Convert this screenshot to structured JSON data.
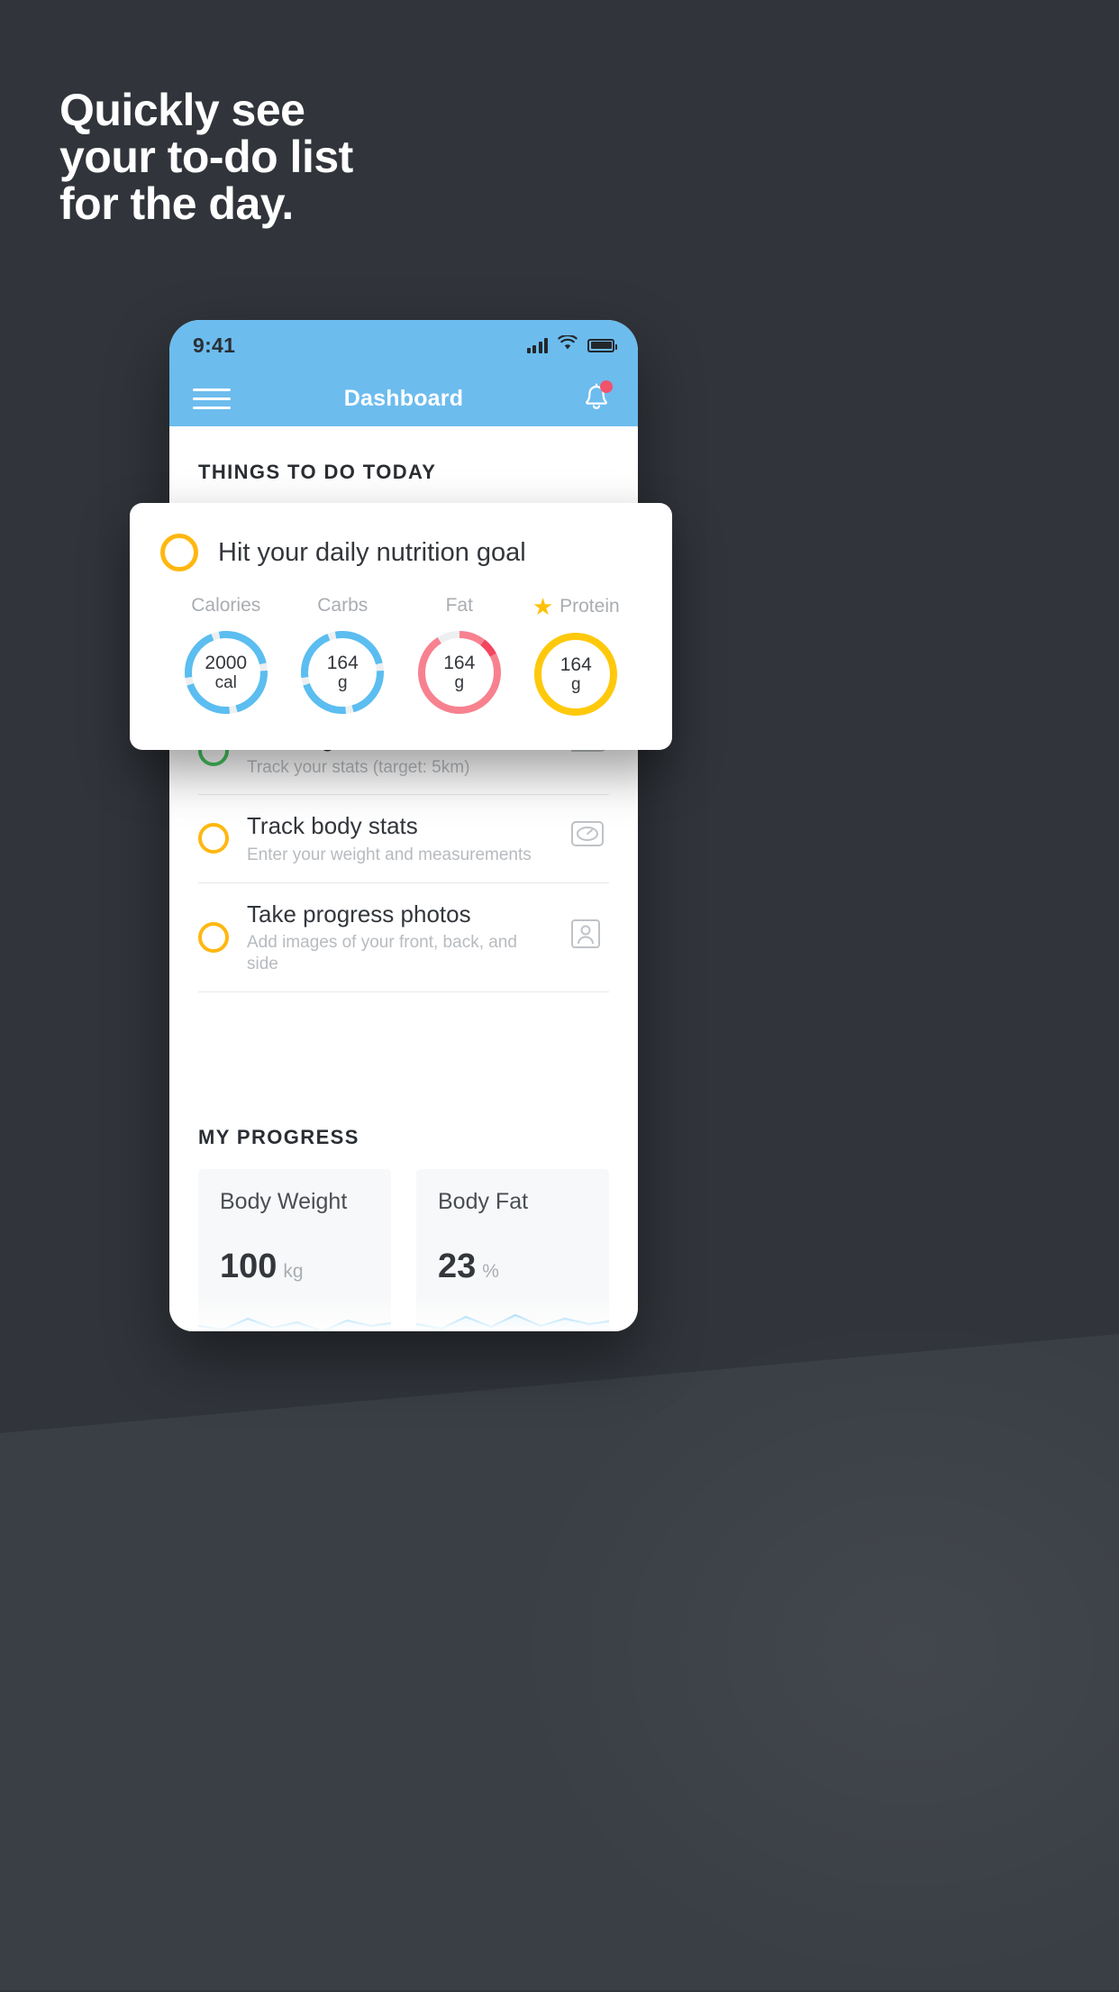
{
  "headline": {
    "line1": "Quickly see",
    "line2": "your to-do list",
    "line3": "for the day."
  },
  "colors": {
    "background": "#31353B",
    "accent_blue": "#6CBCEE",
    "accent_yellow": "#FFB710",
    "accent_green": "#46C45E",
    "accent_red": "#F8818F",
    "notification_dot": "#F0536B"
  },
  "phone": {
    "status_bar": {
      "time": "9:41",
      "signal_icon": "signal-bars-icon",
      "wifi_icon": "wifi-icon",
      "battery_icon": "battery-icon"
    },
    "app_bar": {
      "menu_icon": "hamburger-menu-icon",
      "title": "Dashboard",
      "notification_icon": "bell-icon"
    },
    "todo_section": {
      "title": "THINGS TO DO TODAY",
      "items": [
        {
          "title": "Running",
          "subtitle": "Track your stats (target: 5km)",
          "ring_color": "green",
          "icon": "running-shoe-icon"
        },
        {
          "title": "Track body stats",
          "subtitle": "Enter your weight and measurements",
          "ring_color": "yellow",
          "icon": "scale-icon"
        },
        {
          "title": "Take progress photos",
          "subtitle": "Add images of your front, back, and side",
          "ring_color": "yellow",
          "icon": "photo-person-icon"
        }
      ]
    },
    "progress_section": {
      "title": "MY PROGRESS",
      "cards": [
        {
          "title": "Body Weight",
          "value": "100",
          "unit": "kg"
        },
        {
          "title": "Body Fat",
          "value": "23",
          "unit": "%"
        }
      ]
    }
  },
  "nutrition_card": {
    "ring_color": "yellow",
    "title": "Hit your daily nutrition goal",
    "macros": [
      {
        "label": "Calories",
        "value": "2000",
        "unit": "cal",
        "color": "#5BBDF0",
        "starred": false
      },
      {
        "label": "Carbs",
        "value": "164",
        "unit": "g",
        "color": "#5BBDF0",
        "starred": false
      },
      {
        "label": "Fat",
        "value": "164",
        "unit": "g",
        "color": "#F8818F",
        "starred": false
      },
      {
        "label": "Protein",
        "value": "164",
        "unit": "g",
        "color": "#FFC90B",
        "starred": true
      }
    ],
    "star_icon": "star-icon"
  },
  "chart_data": [
    {
      "type": "line",
      "title": "Body Weight",
      "ylabel": "kg",
      "values": [
        100,
        98,
        101,
        99,
        100,
        97,
        100,
        99
      ],
      "current": 100
    },
    {
      "type": "line",
      "title": "Body Fat",
      "ylabel": "%",
      "values": [
        23,
        22,
        24,
        22,
        25,
        23,
        24,
        23
      ],
      "current": 23
    }
  ]
}
